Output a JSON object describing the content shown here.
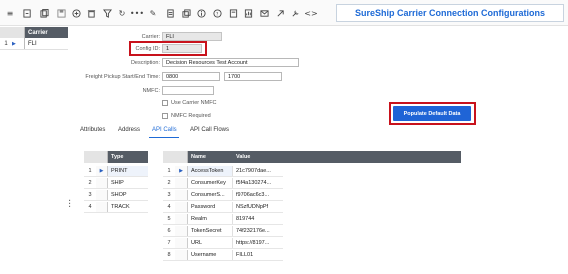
{
  "toolbar": {
    "title": "SureShip Carrier Connection Configurations",
    "icons": [
      "menu-icon",
      "new-record-icon",
      "copy-icon",
      "save-icon",
      "add-circle-icon",
      "delete-icon",
      "filter-icon",
      "refresh-icon",
      "more-icon",
      "edit-icon",
      "document-icon",
      "duplicate-icon",
      "info-icon",
      "help-icon",
      "notes-icon",
      "report-icon",
      "mail-icon",
      "link-icon",
      "tools-icon",
      "expand-icon"
    ]
  },
  "carrier_list": {
    "header": "Carrier",
    "rows": [
      {
        "num": "1",
        "value": "FLI"
      }
    ]
  },
  "form": {
    "carrier_label": "Carrier:",
    "carrier_value": "FLI",
    "config_id_label": "Config ID:",
    "config_id_value": "1",
    "description_label": "Description:",
    "description_value": "Decision Resources Test Account",
    "pickup_label": "Freight Pickup Start/End Time:",
    "pickup_start": "0800",
    "pickup_end": "1700",
    "nmfc_label": "NMFC:",
    "nmfc_value": "",
    "use_carrier_nmfc_label": "Use Carrier NMFC",
    "nmfc_required_label": "NMFC Required",
    "populate_button": "Populate Default Data"
  },
  "tabs": [
    "Attributes",
    "Address",
    "API Calls",
    "API Call Flows"
  ],
  "active_tab": "API Calls",
  "type_table": {
    "header": "Type",
    "rows": [
      {
        "num": "1",
        "value": "PRINT"
      },
      {
        "num": "2",
        "value": "SHIP"
      },
      {
        "num": "3",
        "value": "SHOP"
      },
      {
        "num": "4",
        "value": "TRACK"
      }
    ]
  },
  "nv_table": {
    "headers": [
      "Name",
      "Value"
    ],
    "rows": [
      {
        "num": "1",
        "name": "AccessToken",
        "value": "21c7907dae..."
      },
      {
        "num": "2",
        "name": "ConsumerKey",
        "value": "f5f4a130274..."
      },
      {
        "num": "3",
        "name": "ConsumerS...",
        "value": "f9706ac6c3..."
      },
      {
        "num": "4",
        "name": "Password",
        "value": "NSzfUDNpPf"
      },
      {
        "num": "5",
        "name": "Realm",
        "value": "819744"
      },
      {
        "num": "6",
        "name": "TokenSecret",
        "value": "74f232176e..."
      },
      {
        "num": "7",
        "name": "URL",
        "value": "https://8197..."
      },
      {
        "num": "8",
        "name": "Username",
        "value": "FILL01"
      }
    ]
  },
  "colors": {
    "accent": "#1e6ad6",
    "header_bg": "#555c65",
    "highlight": "#c8121c"
  }
}
